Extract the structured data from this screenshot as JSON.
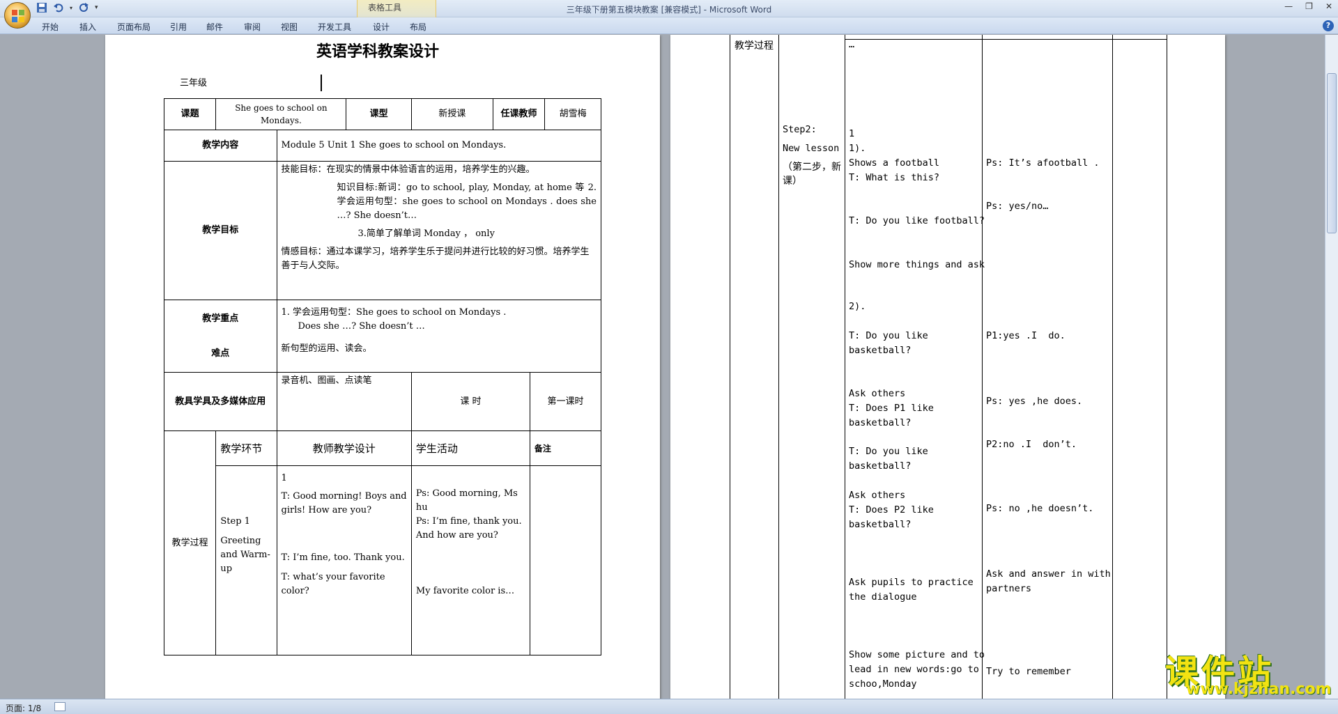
{
  "window": {
    "title": "三年级下册第五模块教案 [兼容模式] - Microsoft Word",
    "contextual_group": "表格工具"
  },
  "ribbon": {
    "tabs": [
      "开始",
      "插入",
      "页面布局",
      "引用",
      "邮件",
      "审阅",
      "视图",
      "开发工具",
      "设计",
      "布局"
    ]
  },
  "status": {
    "page": "页面: 1/8"
  },
  "watermark": {
    "cn": "课件站",
    "url": "www.kjzhan.com"
  },
  "page1": {
    "title": "英语学科教案设计",
    "grade": "三年级",
    "row1": {
      "l1": "课题",
      "v1": "She goes to school on Mondays.",
      "l2": "课型",
      "v2": "新授课",
      "l3": "任课教师",
      "v3": "胡雪梅"
    },
    "row2": {
      "l": "教学内容",
      "v": "Module 5 Unit 1 She goes to school on Mondays."
    },
    "row3": {
      "l": "教学目标",
      "v1": "技能目标：在现实的情景中体验语言的运用，培养学生的兴趣。",
      "v2a": "知识目标:新词：go to school, play, Monday, at home 等  2.学会运用句型：she goes to school on Mondays . does she …?   She doesn’t…",
      "v2b": "3.简单了解单词 Monday ， only",
      "v3": "情感目标：通过本课学习，培养学生乐于提问并进行比较的好习惯。培养学生善于与人交际。"
    },
    "row4": {
      "l1": "教学重点",
      "l2": "难点",
      "v1": "1. 学会运用句型：She goes to school on Mondays .",
      "v2": "Does she  …?    She doesn’t …",
      "v3": "新句型的运用、读会。"
    },
    "row5": {
      "l": "教具学具及多媒体应用",
      "v1": "录音机、图画、点读笔",
      "v2": "课  时",
      "v3": "第一课时"
    },
    "row6": {
      "l": "教学过程",
      "h1": "教学环节",
      "h2": "教师教学设计",
      "h3": "学生活动",
      "h4": "备注",
      "c1": [
        "Step 1",
        "Greeting",
        "and Warm-",
        "up"
      ],
      "c2": [
        "1",
        "T: Good morning! Boys and girls! How are you?",
        "T: I’m fine, too. Thank you.",
        "T: what’s your favorite color?"
      ],
      "c3": [
        "Ps: Good morning,   Ms hu",
        "Ps: I’m fine, thank you. And how are you?",
        "My favorite color is…"
      ]
    }
  },
  "page2": {
    "left_label": "教学过程",
    "c1": [
      "Step2:",
      "New lesson",
      "（第二步，新课）"
    ],
    "c2": [
      "…",
      "1",
      "1).",
      "Shows a football",
      "T: What is this?",
      "T: Do you like football?",
      "Show more things and ask",
      "2).",
      "T: Do you like",
      "basketball?",
      "Ask others",
      "T: Does P1 like",
      "basketball?",
      "T: Do you like",
      "basketball?",
      "Ask others",
      "T: Does P2 like",
      "basketball?",
      "Ask pupils to practice",
      "the dialogue",
      "Show some picture and to",
      "lead in new words:go to",
      "schoo,Monday"
    ],
    "c3": [
      "Ps: It’s afootball .",
      "Ps: yes/no…",
      "P1:yes .I  do.",
      "Ps: yes ,he does.",
      "P2:no .I  don’t.",
      "Ps: no ,he doesn’t.",
      "Ask and answer in with",
      "partners",
      "Try to remember"
    ]
  }
}
